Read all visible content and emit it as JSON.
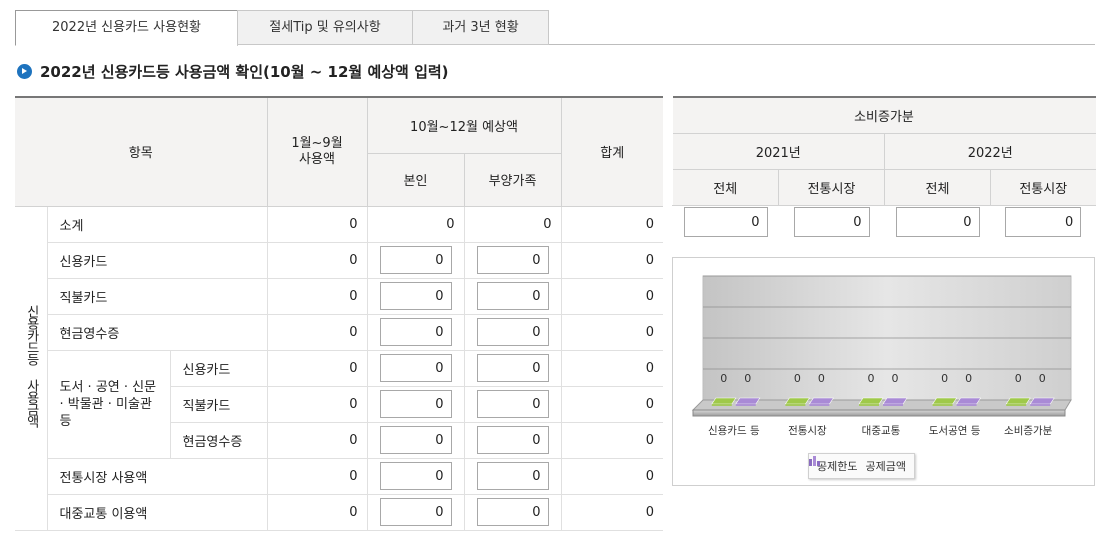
{
  "tabs": [
    {
      "label": "2022년 신용카드 사용현황",
      "active": true
    },
    {
      "label": "절세Tip 및 유의사항",
      "active": false
    },
    {
      "label": "과거 3년 현황",
      "active": false
    }
  ],
  "heading": "2022년 신용카드등 사용금액 확인(10월 ~ 12월 예상액 입력)",
  "main_table": {
    "headers": {
      "item": "항목",
      "jan_sep": "1월~9월\n사용액",
      "oct_dec": "10월~12월 예상액",
      "self": "본인",
      "dependent": "부양가족",
      "total": "합계"
    },
    "group_label": "신용카드등 사용금액",
    "culture_label": "도서 · 공연 · 신문 · 박물관 · 미술관 등",
    "rows": {
      "subtotal": {
        "label": "소계",
        "jan_sep": "0",
        "self": "0",
        "dependent": "0",
        "total": "0"
      },
      "credit": {
        "label": "신용카드",
        "jan_sep": "0",
        "self": "0",
        "dependent": "0",
        "total": "0"
      },
      "debit": {
        "label": "직불카드",
        "jan_sep": "0",
        "self": "0",
        "dependent": "0",
        "total": "0"
      },
      "cash": {
        "label": "현금영수증",
        "jan_sep": "0",
        "self": "0",
        "dependent": "0",
        "total": "0"
      },
      "culture_credit": {
        "label": "신용카드",
        "jan_sep": "0",
        "self": "0",
        "dependent": "0",
        "total": "0"
      },
      "culture_debit": {
        "label": "직불카드",
        "jan_sep": "0",
        "self": "0",
        "dependent": "0",
        "total": "0"
      },
      "culture_cash": {
        "label": "현금영수증",
        "jan_sep": "0",
        "self": "0",
        "dependent": "0",
        "total": "0"
      },
      "market": {
        "label": "전통시장 사용액",
        "jan_sep": "0",
        "self": "0",
        "dependent": "0",
        "total": "0"
      },
      "transit": {
        "label": "대중교통 이용액",
        "jan_sep": "0",
        "self": "0",
        "dependent": "0",
        "total": "0"
      }
    }
  },
  "right_table": {
    "title": "소비증가분",
    "y2021": "2021년",
    "y2022": "2022년",
    "total": "전체",
    "market": "전통시장",
    "values": [
      "0",
      "0",
      "0",
      "0"
    ]
  },
  "chart_data": {
    "type": "bar",
    "categories": [
      "신용카드 등",
      "전통시장",
      "대중교통",
      "도서공연 등",
      "소비증가분"
    ],
    "series": [
      {
        "name": "공제한도",
        "values": [
          0,
          0,
          0,
          0,
          0
        ],
        "color": "#9fc94a"
      },
      {
        "name": "공제금액",
        "values": [
          0,
          0,
          0,
          0,
          0
        ],
        "color": "#a98ad6"
      }
    ],
    "labels": [
      [
        "0",
        "0"
      ],
      [
        "0",
        "0"
      ],
      [
        "0",
        "0"
      ],
      [
        "0",
        "0"
      ],
      [
        "0",
        "0"
      ]
    ],
    "ylim": [
      0,
      1
    ],
    "grid": true,
    "legend": "bottom"
  }
}
